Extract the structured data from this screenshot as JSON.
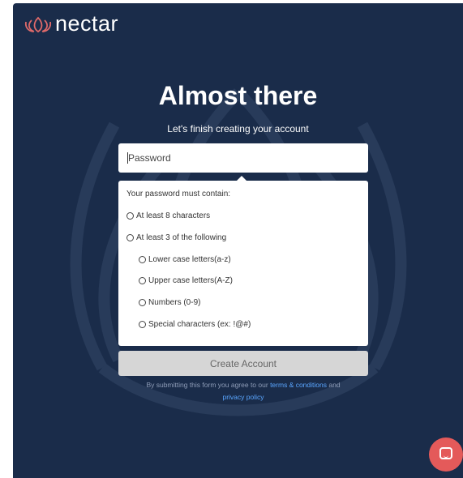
{
  "brand": {
    "name": "nectar",
    "accent": "#e06a6a",
    "panel_bg": "#1a2c4a"
  },
  "header": {
    "title": "Almost there",
    "subtitle": "Let's finish creating your account"
  },
  "form": {
    "password_placeholder": "Password",
    "requirements_title": "Your password must contain:",
    "requirements": [
      {
        "label": "At least 8 characters",
        "met": false
      },
      {
        "label": "At least 3 of the following",
        "met": false
      }
    ],
    "sub_requirements": [
      {
        "label": "Lower case letters(a-z)",
        "met": false
      },
      {
        "label": "Upper case letters(A-Z)",
        "met": false
      },
      {
        "label": "Numbers (0-9)",
        "met": false
      },
      {
        "label": "Special characters (ex: !@#)",
        "met": false
      }
    ],
    "submit_label": "Create Account"
  },
  "legal": {
    "prefix": "By submitting this form you agree to our",
    "terms_link": "terms & conditions",
    "joiner": "and",
    "privacy_link": "privacy policy"
  },
  "chat": {
    "icon": "chat-bubble-icon",
    "color": "#e45a5a"
  }
}
